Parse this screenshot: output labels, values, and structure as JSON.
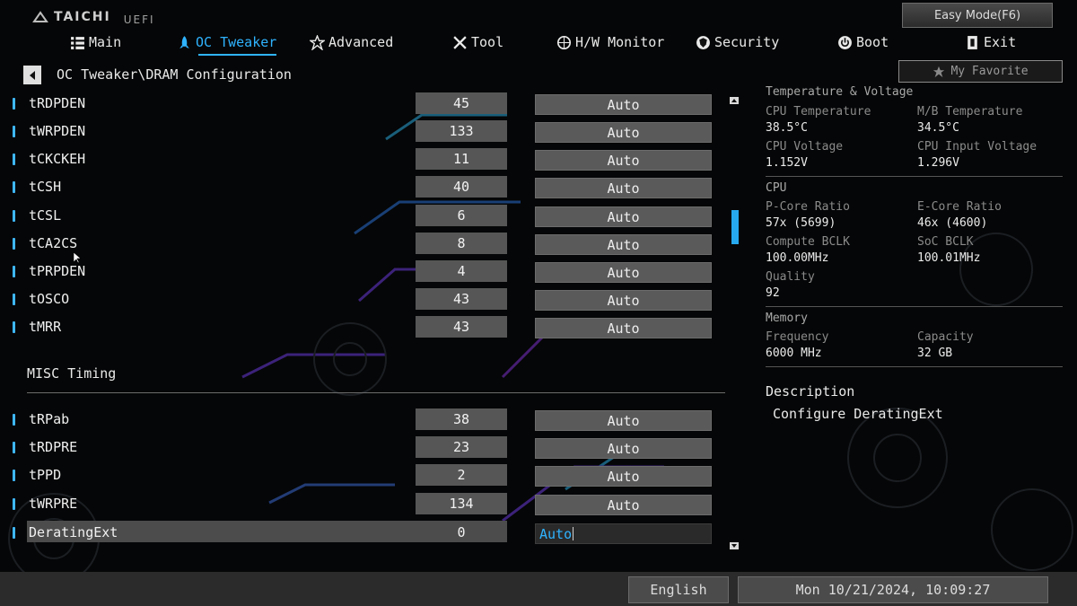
{
  "brand": {
    "name": "TAICHI",
    "sub": "UEFI"
  },
  "easy_mode": "Easy Mode(F6)",
  "nav": [
    {
      "label": "Main",
      "icon": "list-icon",
      "active": false
    },
    {
      "label": "OC Tweaker",
      "icon": "rocket-icon",
      "active": true
    },
    {
      "label": "Advanced",
      "icon": "star-icon",
      "active": false
    },
    {
      "label": "Tool",
      "icon": "tools-icon",
      "active": false
    },
    {
      "label": "H/W Monitor",
      "icon": "monitor-icon",
      "active": false
    },
    {
      "label": "Security",
      "icon": "shield-icon",
      "active": false
    },
    {
      "label": "Boot",
      "icon": "power-icon",
      "active": false
    },
    {
      "label": "Exit",
      "icon": "exit-icon",
      "active": false
    }
  ],
  "breadcrumb": "OC Tweaker\\DRAM Configuration",
  "favorite": "My Favorite",
  "settings": [
    {
      "name": "tRDPDEN",
      "value": "45",
      "option": "Auto"
    },
    {
      "name": "tWRPDEN",
      "value": "133",
      "option": "Auto"
    },
    {
      "name": "tCKCKEH",
      "value": "11",
      "option": "Auto"
    },
    {
      "name": "tCSH",
      "value": "40",
      "option": "Auto"
    },
    {
      "name": "tCSL",
      "value": "6",
      "option": "Auto"
    },
    {
      "name": "tCA2CS",
      "value": "8",
      "option": "Auto"
    },
    {
      "name": "tPRPDEN",
      "value": "4",
      "option": "Auto"
    },
    {
      "name": "tOSCO",
      "value": "43",
      "option": "Auto"
    },
    {
      "name": "tMRR",
      "value": "43",
      "option": "Auto"
    }
  ],
  "misc_section": "MISC Timing",
  "misc_settings": [
    {
      "name": "tRPab",
      "value": "38",
      "option": "Auto"
    },
    {
      "name": "tRDPRE",
      "value": "23",
      "option": "Auto"
    },
    {
      "name": "tPPD",
      "value": "2",
      "option": "Auto"
    },
    {
      "name": "tWRPRE",
      "value": "134",
      "option": "Auto"
    },
    {
      "name": "DeratingExt",
      "value": "0",
      "option": "Auto",
      "selected": true
    }
  ],
  "right_panel": {
    "temp_voltage": {
      "title": "Temperature & Voltage",
      "cpu_temp_label": "CPU Temperature",
      "cpu_temp": "38.5°C",
      "mb_temp_label": "M/B Temperature",
      "mb_temp": "34.5°C",
      "cpu_voltage_label": "CPU Voltage",
      "cpu_voltage": "1.152V",
      "cpu_input_label": "CPU Input Voltage",
      "cpu_input": "1.296V"
    },
    "cpu": {
      "title": "CPU",
      "pcore_label": "P-Core Ratio",
      "pcore": "57x (5699)",
      "ecore_label": "E-Core Ratio",
      "ecore": "46x (4600)",
      "compute_label": "Compute BCLK",
      "compute": "100.00MHz",
      "soc_label": "SoC BCLK",
      "soc": "100.01MHz",
      "quality_label": "Quality",
      "quality": "92"
    },
    "memory": {
      "title": "Memory",
      "freq_label": "Frequency",
      "freq": "6000 MHz",
      "cap_label": "Capacity",
      "cap": "32 GB"
    },
    "description_title": "Description",
    "description": "Configure DeratingExt"
  },
  "footer": {
    "language": "English",
    "datetime": "Mon 10/21/2024, 10:09:27"
  },
  "colors": {
    "accent": "#2fb3ff",
    "bg": "#050607",
    "field": "#565656"
  }
}
